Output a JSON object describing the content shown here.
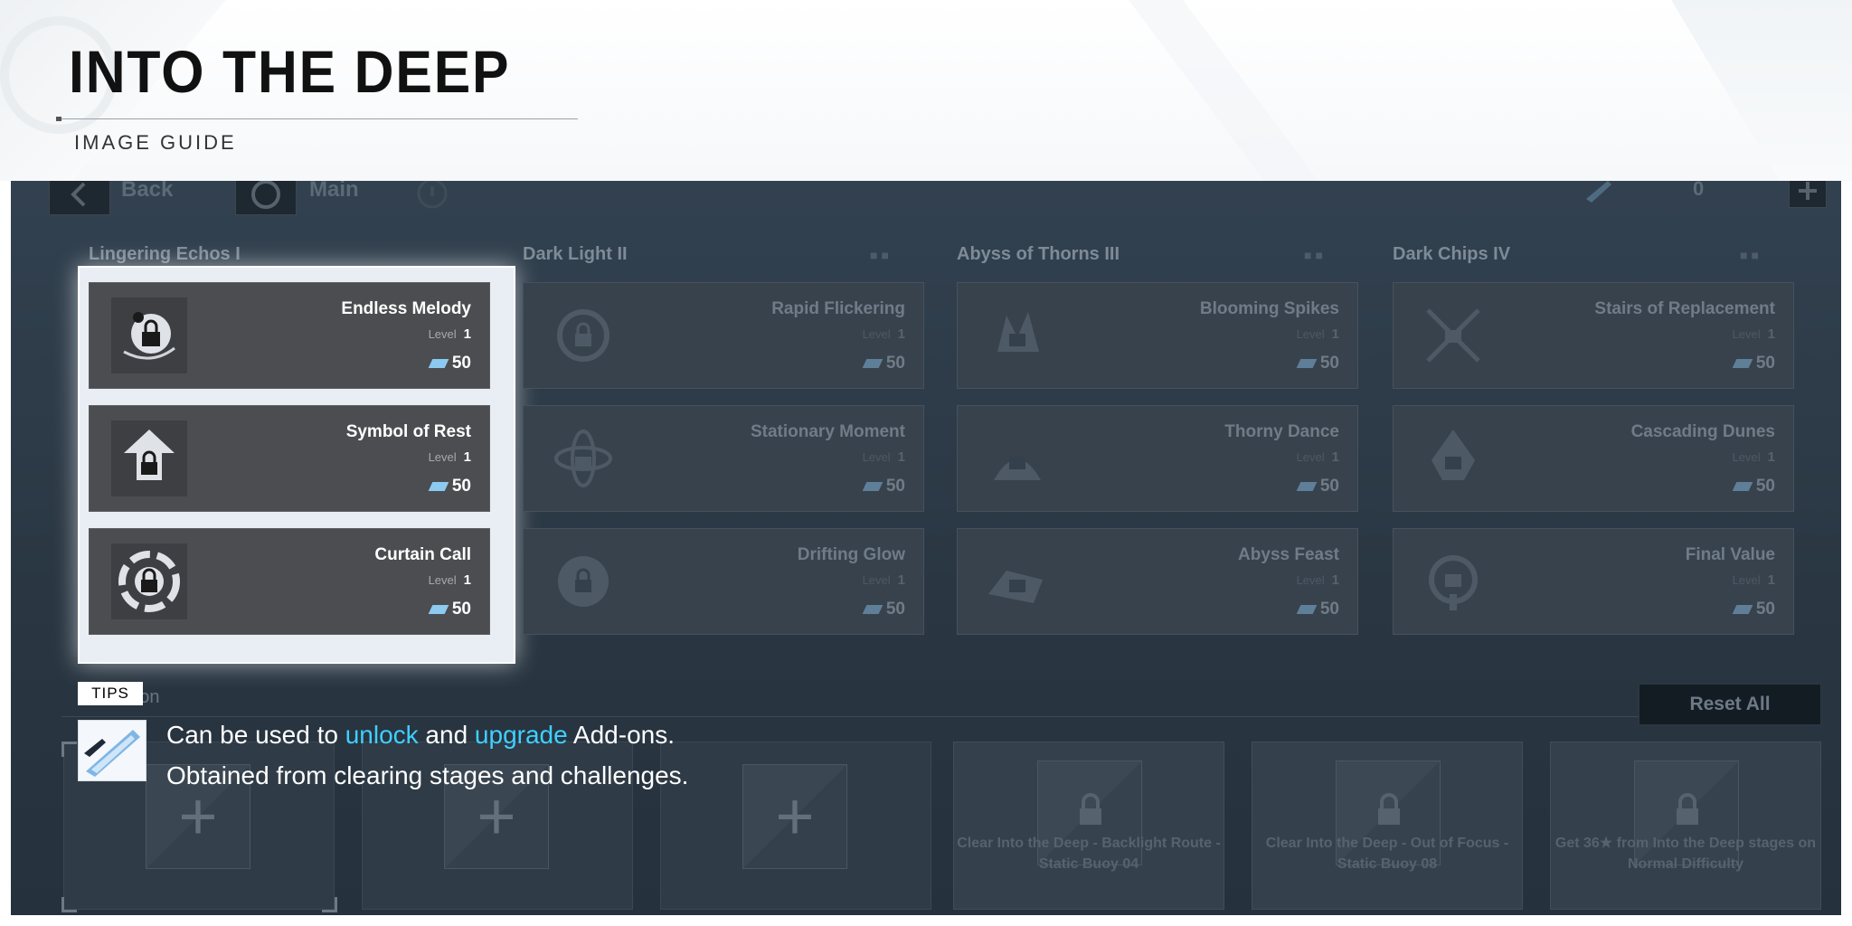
{
  "header": {
    "title": "INTO THE DEEP",
    "subtitle": "IMAGE GUIDE"
  },
  "topbar": {
    "back_label": "Back",
    "main_label": "Main",
    "currency_count": "0"
  },
  "columns": [
    {
      "title": "Lingering Echos I",
      "highlighted": true,
      "cards": [
        {
          "name": "Endless Melody",
          "level_label": "Level",
          "level": "1",
          "cost": "50",
          "icon": "melody-lock-icon"
        },
        {
          "name": "Symbol of Rest",
          "level_label": "Level",
          "level": "1",
          "cost": "50",
          "icon": "house-lock-icon"
        },
        {
          "name": "Curtain Call",
          "level_label": "Level",
          "level": "1",
          "cost": "50",
          "icon": "vortex-lock-icon"
        }
      ]
    },
    {
      "title": "Dark Light II",
      "highlighted": false,
      "cards": [
        {
          "name": "Rapid Flickering",
          "level_label": "Level",
          "level": "1",
          "cost": "50",
          "icon": "flicker-lock-icon"
        },
        {
          "name": "Stationary Moment",
          "level_label": "Level",
          "level": "1",
          "cost": "50",
          "icon": "atom-lock-icon"
        },
        {
          "name": "Drifting Glow",
          "level_label": "Level",
          "level": "1",
          "cost": "50",
          "icon": "glow-lock-icon"
        }
      ]
    },
    {
      "title": "Abyss of Thorns III",
      "highlighted": false,
      "cards": [
        {
          "name": "Blooming Spikes",
          "level_label": "Level",
          "level": "1",
          "cost": "50",
          "icon": "spikes-lock-icon"
        },
        {
          "name": "Thorny Dance",
          "level_label": "Level",
          "level": "1",
          "cost": "50",
          "icon": "thorn-lock-icon"
        },
        {
          "name": "Abyss Feast",
          "level_label": "Level",
          "level": "1",
          "cost": "50",
          "icon": "feast-lock-icon"
        }
      ]
    },
    {
      "title": "Dark Chips IV",
      "highlighted": false,
      "cards": [
        {
          "name": "Stairs of Replacement",
          "level_label": "Level",
          "level": "1",
          "cost": "50",
          "icon": "stairs-lock-icon"
        },
        {
          "name": "Cascading Dunes",
          "level_label": "Level",
          "level": "1",
          "cost": "50",
          "icon": "dunes-lock-icon"
        },
        {
          "name": "Final Value",
          "level_label": "Level",
          "level": "1",
          "cost": "50",
          "icon": "value-lock-icon"
        }
      ]
    }
  ],
  "addon": {
    "label": "Add-on",
    "reset_label": "Reset All",
    "locked_slots": [
      "Clear Into the Deep - Backlight Route - Static Buoy 04",
      "Clear Into the Deep - Out of Focus - Static Buoy 08",
      "Get 36★ from Into the Deep stages on Normal Difficulty"
    ]
  },
  "tips": {
    "tag": "TIPS",
    "line1_pre": "Can be used to ",
    "line1_hl1": "unlock",
    "line1_mid": " and ",
    "line1_hl2": "upgrade",
    "line1_post": " Add-ons.",
    "line2": "Obtained from clearing stages and challenges."
  },
  "colors": {
    "highlight_text": "#3fd0ff",
    "game_bg": "#28343f"
  }
}
